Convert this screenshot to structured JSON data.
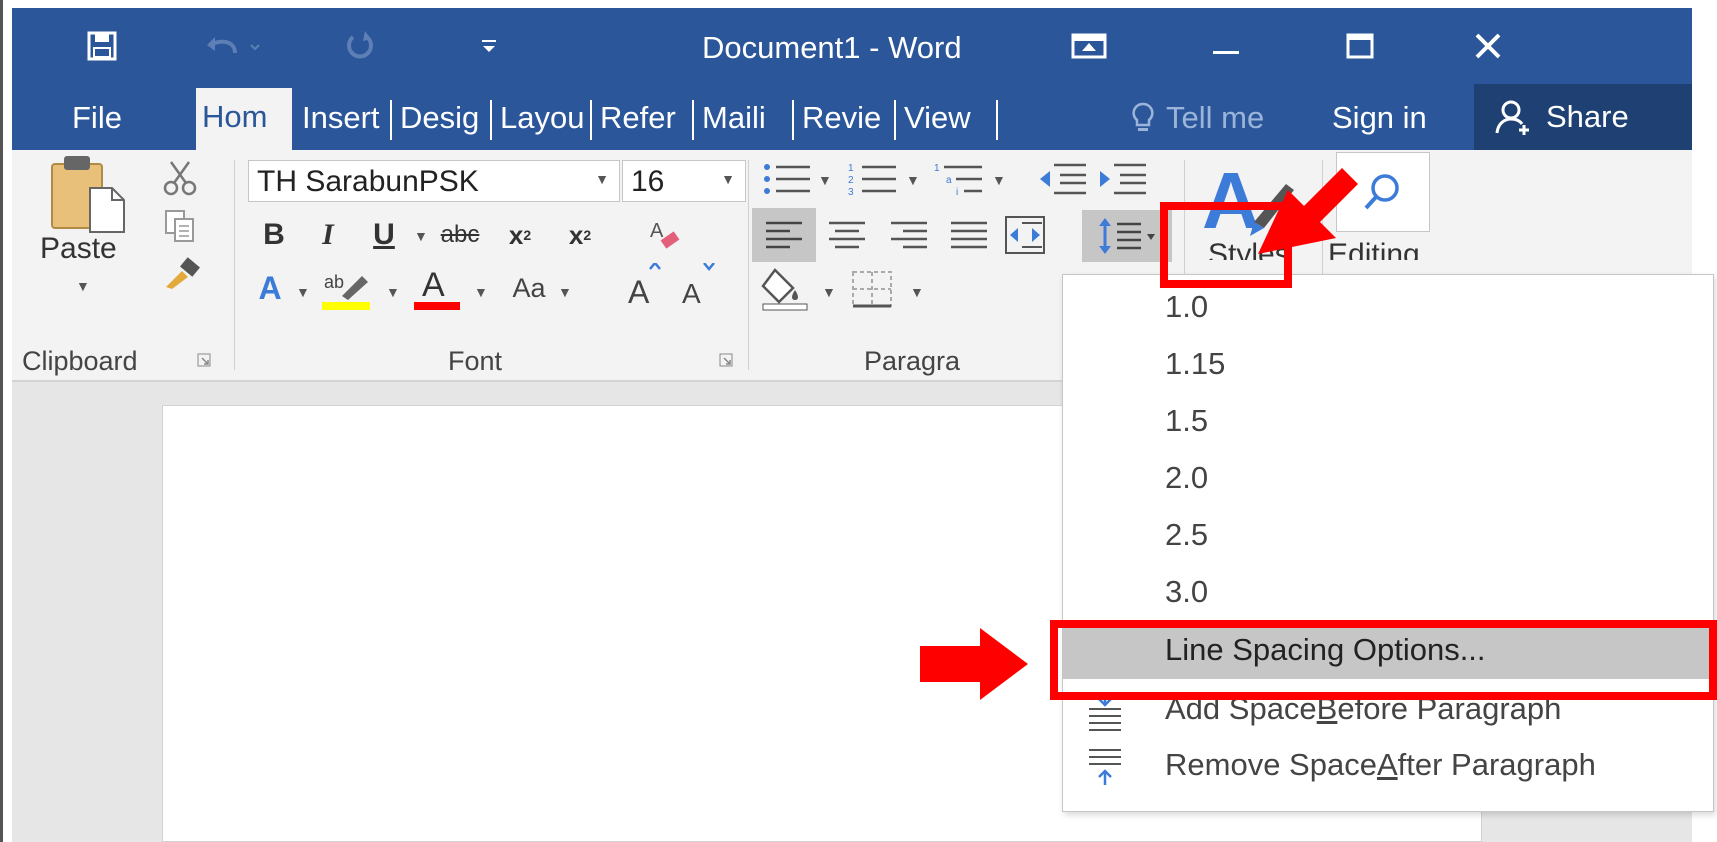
{
  "window": {
    "title": "Document1 - Word"
  },
  "tabs": [
    {
      "label": "File"
    },
    {
      "label": "Hom"
    },
    {
      "label": "Insert"
    },
    {
      "label": "Desig"
    },
    {
      "label": "Layou"
    },
    {
      "label": "Refer"
    },
    {
      "label": "Maili"
    },
    {
      "label": "Revie"
    },
    {
      "label": "View"
    }
  ],
  "tell_me": "Tell me",
  "sign_in": "Sign in",
  "share": "Share",
  "clipboard": {
    "paste_label": "Paste",
    "group_label": "Clipboard"
  },
  "font": {
    "name": "TH SarabunPSK",
    "size": "16",
    "group_label": "Font",
    "change_case": "Aa"
  },
  "paragraph": {
    "group_label": "Paragra"
  },
  "styles": {
    "label": "Styles"
  },
  "editing": {
    "label": "Editing"
  },
  "line_spacing_menu": {
    "options": [
      "1.0",
      "1.15",
      "1.5",
      "2.0",
      "2.5",
      "3.0"
    ],
    "line_spacing_options": "Line Spacing Options...",
    "add_space_before": {
      "pre": "Add Space ",
      "accel": "B",
      "post": "efore Paragraph"
    },
    "remove_space_after": {
      "pre": "Remove Space ",
      "accel": "A",
      "post": "fter Paragraph"
    }
  },
  "colors": {
    "word_blue": "#2b579a",
    "callout_red": "#ff0000",
    "menu_highlight": "#c6c6c6",
    "highlight_yellow": "#ffff00",
    "font_color_red": "#ff0000"
  }
}
